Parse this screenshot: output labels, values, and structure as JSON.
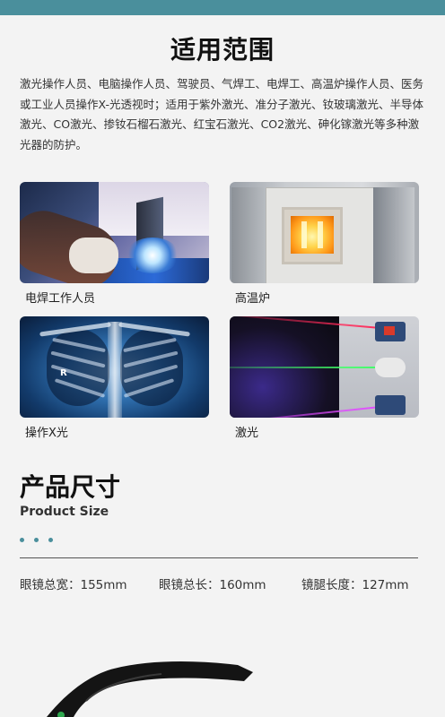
{
  "scope": {
    "title": "适用范围",
    "description": "激光操作人员、电脑操作人员、驾驶员、气焊工、电焊工、高温炉操作人员、医务或工业人员操作X-光透视时；适用于紫外激光、准分子激光、钕玻璃激光、半导体激光、CO激光、掺钕石榴石激光、红宝石激光、CO2激光、砷化镓激光等多种激光器的防护。",
    "cards": [
      {
        "caption": "电焊工作人员"
      },
      {
        "caption": "高温炉"
      },
      {
        "caption": "操作X光"
      },
      {
        "caption": "激光"
      }
    ],
    "xray_marker": "R"
  },
  "size": {
    "title": "产品尺寸",
    "subtitle": "Product Size",
    "specs": [
      {
        "text": "眼镜总宽：155mm"
      },
      {
        "text": "眼镜总长：160mm"
      },
      {
        "text": "镜腿长度：127mm"
      }
    ]
  },
  "colors": {
    "accent": "#4a8f9c",
    "background": "#f3f3f3"
  }
}
